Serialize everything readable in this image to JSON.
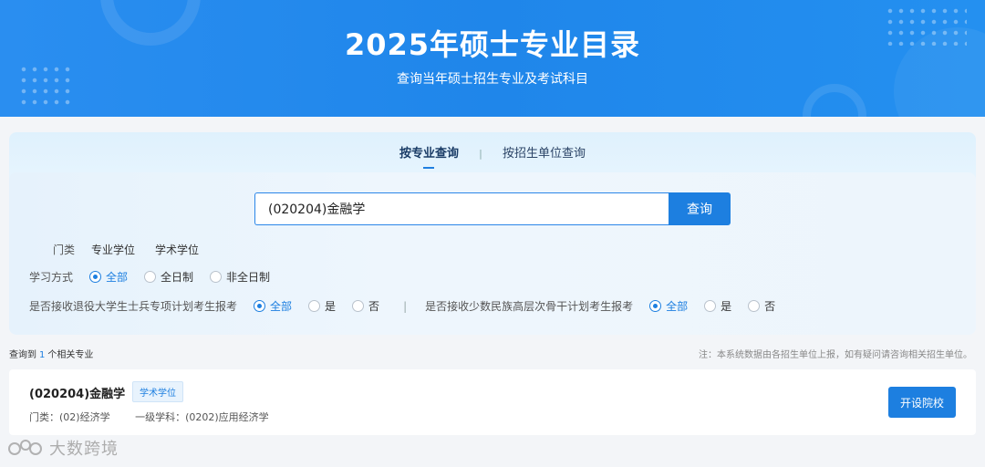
{
  "banner": {
    "title": "2025年硕士专业目录",
    "subtitle": "查询当年硕士招生专业及考试科目"
  },
  "tabs": [
    {
      "label": "按专业查询",
      "active": true
    },
    {
      "label": "按招生单位查询",
      "active": false
    }
  ],
  "tab_separator": "|",
  "search": {
    "value": "(020204)金融学",
    "button_label": "查询"
  },
  "filters": {
    "category": {
      "label": "门类",
      "options": [
        "专业学位",
        "学术学位"
      ]
    },
    "study_mode": {
      "label": "学习方式",
      "options": [
        "全部",
        "全日制",
        "非全日制"
      ],
      "selected": "全部"
    },
    "veteran_plan": {
      "label": "是否接收退役大学生士兵专项计划考生报考",
      "options": [
        "全部",
        "是",
        "否"
      ],
      "selected": "全部"
    },
    "minority_plan": {
      "label": "是否接收少数民族高层次骨干计划考生报考",
      "options": [
        "全部",
        "是",
        "否"
      ],
      "selected": "全部"
    },
    "separator": "|"
  },
  "summary": {
    "prefix": "查询到",
    "count": "1",
    "suffix": "个相关专业",
    "note": "注：本系统数据由各招生单位上报，如有疑问请咨询相关招生单位。"
  },
  "result": {
    "title": "(020204)金融学",
    "badge": "学术学位",
    "category": "门类：(02)经济学",
    "discipline": "一级学科：(0202)应用经济学",
    "button_label": "开设院校"
  },
  "watermark": {
    "text": "大数跨境"
  },
  "colors": {
    "accent": "#1d7fe0",
    "banner": "#2a8ef0"
  }
}
